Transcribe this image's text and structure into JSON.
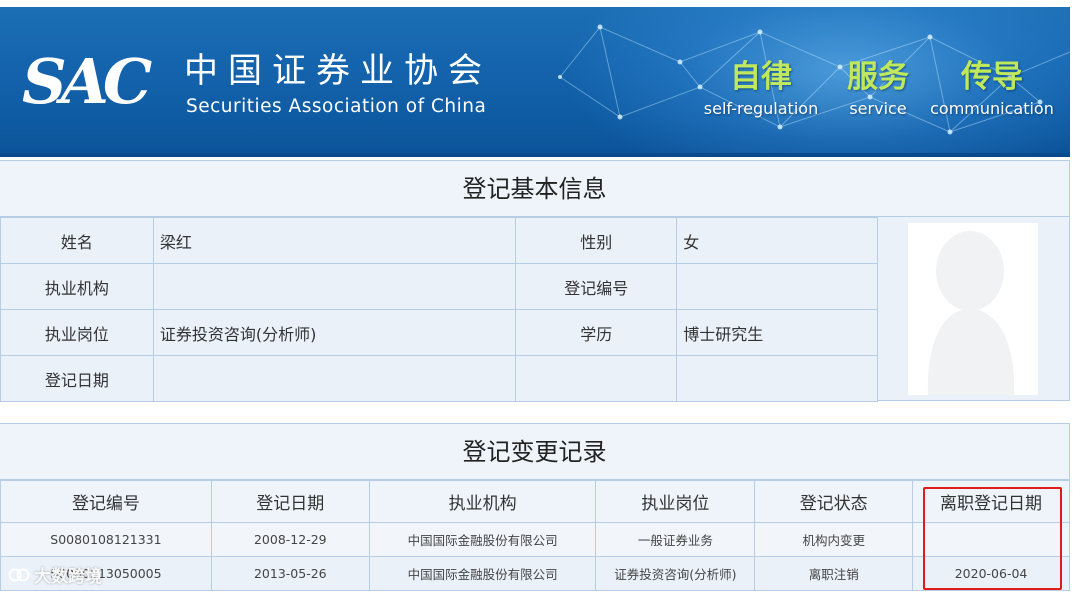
{
  "header": {
    "logo_text": "SAC",
    "org_name_cn": "中国证券业协会",
    "org_name_en": "Securities Association of China",
    "slogans": [
      {
        "cn": "自律",
        "en": "self-regulation"
      },
      {
        "cn": "服务",
        "en": "service"
      },
      {
        "cn": "传导",
        "en": "communication"
      }
    ]
  },
  "basic_info": {
    "title": "登记基本信息",
    "name_label": "姓名",
    "name_value": "梁红",
    "gender_label": "性别",
    "gender_value": "女",
    "org_label": "执业机构",
    "org_value": "",
    "reg_no_label": "登记编号",
    "reg_no_value": "",
    "position_label": "执业岗位",
    "position_value": "证券投资咨询(分析师)",
    "education_label": "学历",
    "education_value": "博士研究生",
    "reg_date_label": "登记日期",
    "reg_date_value": ""
  },
  "change_records": {
    "title": "登记变更记录",
    "columns": [
      "登记编号",
      "登记日期",
      "执业机构",
      "执业岗位",
      "登记状态",
      "离职登记日期"
    ],
    "rows": [
      [
        "S0080108121331",
        "2008-12-29",
        "中国国际金融股份有限公司",
        "一般证券业务",
        "机构内变更",
        ""
      ],
      [
        "S0080513050005",
        "2013-05-26",
        "中国国际金融股份有限公司",
        "证券投资咨询(分析师)",
        "离职注销",
        "2020-06-04"
      ]
    ]
  },
  "watermark": {
    "text": "大数跨境"
  },
  "colors": {
    "banner_blue": "#1565ae",
    "slogan_green": "#bfe85c",
    "panel_bg": "#eaf1f9",
    "border": "#b6cde4",
    "highlight_red": "#e01b1b"
  }
}
